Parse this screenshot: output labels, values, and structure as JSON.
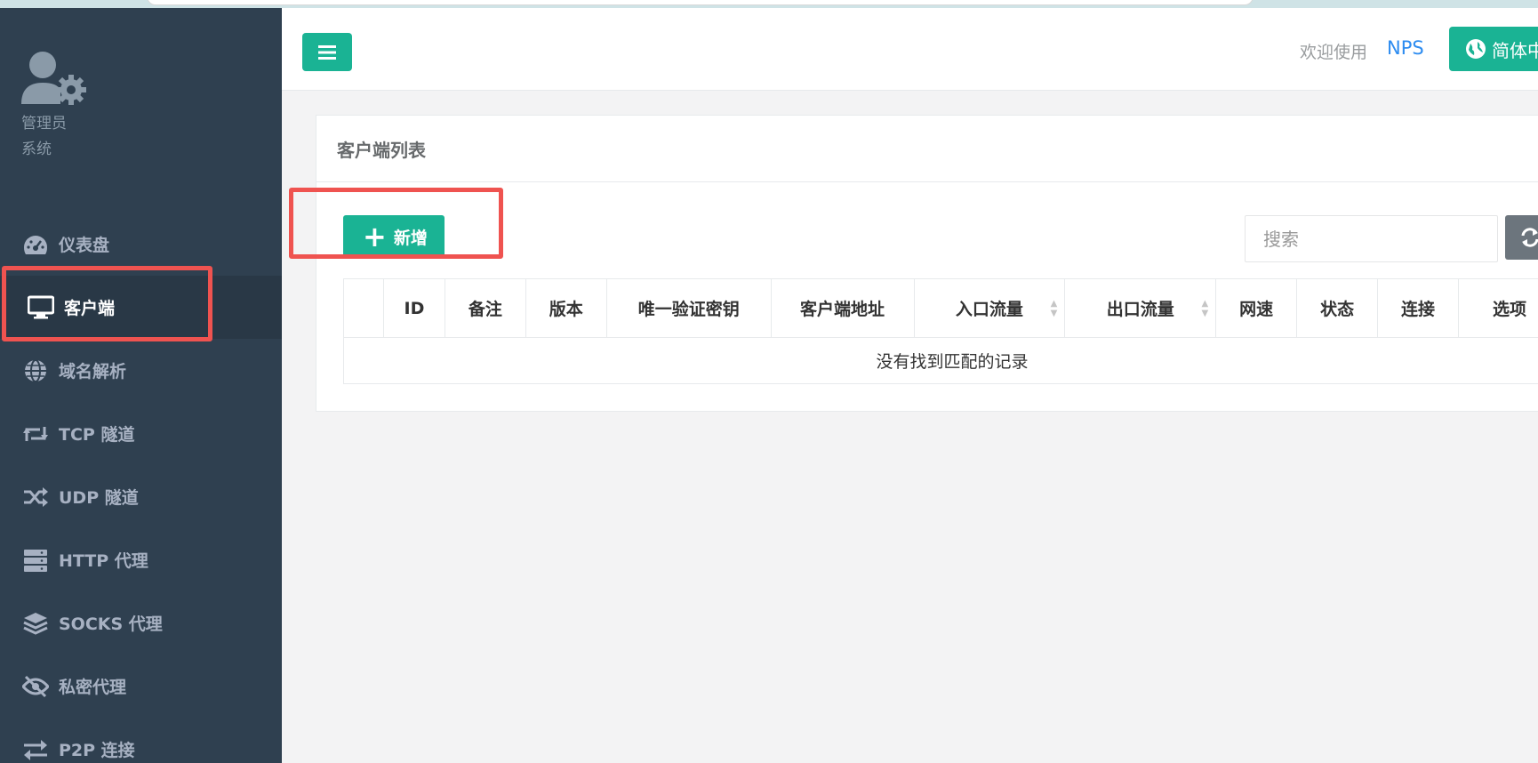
{
  "profile": {
    "role": "管理员",
    "subrole": "系统"
  },
  "nav": [
    {
      "label": "仪表盘",
      "icon": "dashboard-icon"
    },
    {
      "label": "客户端",
      "icon": "monitor-icon"
    },
    {
      "label": "域名解析",
      "icon": "globe-icon"
    },
    {
      "label": "TCP 隧道",
      "icon": "retweet-icon"
    },
    {
      "label": "UDP 隧道",
      "icon": "shuffle-icon"
    },
    {
      "label": "HTTP 代理",
      "icon": "server-icon"
    },
    {
      "label": "SOCKS 代理",
      "icon": "layers-icon"
    },
    {
      "label": "私密代理",
      "icon": "eye-slash-icon"
    },
    {
      "label": "P2P 连接",
      "icon": "exchange-icon"
    }
  ],
  "header": {
    "welcome": "欢迎使用",
    "brand": "NPS",
    "language": "简体中"
  },
  "panel": {
    "title": "客户端列表",
    "add_label": "新增",
    "search_placeholder": "搜索",
    "columns": [
      "",
      "ID",
      "备注",
      "版本",
      "唯一验证密钥",
      "客户端地址",
      "入口流量",
      "出口流量",
      "网速",
      "状态",
      "连接",
      "选项"
    ],
    "empty_message": "没有找到匹配的记录"
  },
  "colors": {
    "accent": "#1ab394",
    "sidebar": "#2f4050",
    "annotation": "#ef5350",
    "link": "#2d8cf0"
  }
}
